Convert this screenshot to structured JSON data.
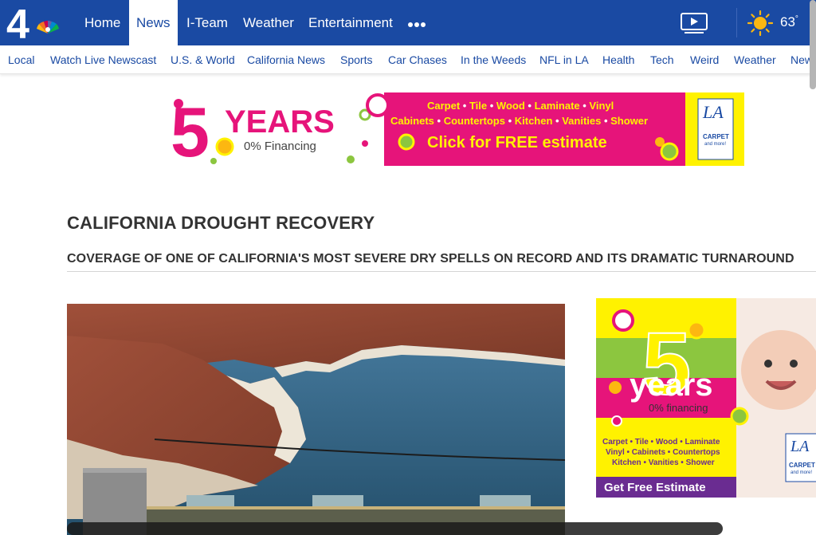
{
  "topnav": {
    "logo_text": "4",
    "items": [
      {
        "label": "Home"
      },
      {
        "label": "News"
      },
      {
        "label": "I-Team"
      },
      {
        "label": "Weather"
      },
      {
        "label": "Entertainment"
      }
    ],
    "active_item": "News",
    "more_icon": "more-dots-icon",
    "video_icon": "video-play-icon",
    "weather_icon": "sun-icon",
    "temperature": "63",
    "temperature_unit": "°"
  },
  "subnav": {
    "items": [
      {
        "label": "Local"
      },
      {
        "label": "Watch Live Newscast"
      },
      {
        "label": "U.S. & World"
      },
      {
        "label": "California News"
      },
      {
        "label": "Sports"
      },
      {
        "label": "Car Chases"
      },
      {
        "label": "In the Weeds"
      },
      {
        "label": "NFL in LA"
      },
      {
        "label": "Health"
      },
      {
        "label": "Tech"
      },
      {
        "label": "Weird"
      },
      {
        "label": "Weather"
      },
      {
        "label": "News"
      }
    ]
  },
  "ad_banner": {
    "big_number": "5",
    "years": "YEARS",
    "financing": "0% Financing",
    "line1": [
      "Carpet",
      "Tile",
      "Wood",
      "Laminate",
      "Vinyl"
    ],
    "line2": [
      "Cabinets",
      "Countertops",
      "Kitchen",
      "Vanities",
      "Shower"
    ],
    "cta": "Click for FREE estimate",
    "brand_logo": "LA",
    "brand_sub": "CARPET",
    "brand_sub2": "and more!"
  },
  "page": {
    "title": "CALIFORNIA DROUGHT RECOVERY",
    "subtitle": "COVERAGE OF ONE OF CALIFORNIA'S MOST SEVERE DRY SPELLS ON RECORD AND ITS DRAMATIC TURNAROUND"
  },
  "ad_side": {
    "big_number": "5",
    "years": "years",
    "financing": "0% financing",
    "line1": "Carpet • Tile • Wood • Laminate",
    "line2": "Vinyl • Cabinets • Countertops",
    "line3": "Kitchen • Vanities • Shower",
    "cta": "Get Free Estimate",
    "brand_logo": "LA",
    "brand_sub": "CARPET",
    "brand_sub2": "and more!"
  },
  "colors": {
    "nav_blue": "#1a4aa3",
    "ad_magenta": "#e6147a",
    "ad_green": "#8cc63f",
    "ad_yellow": "#fff200",
    "ad_purple": "#6a2c91"
  }
}
